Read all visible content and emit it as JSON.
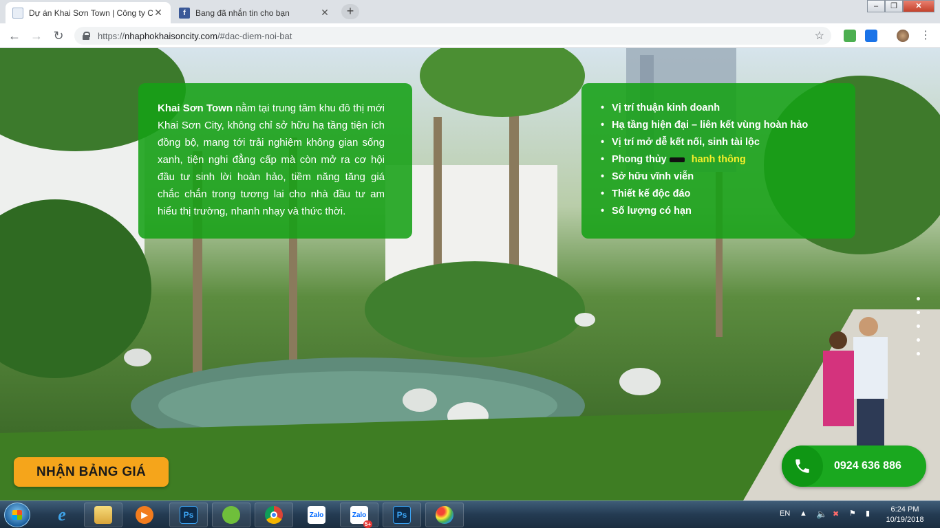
{
  "browser": {
    "tabs": [
      {
        "title": "Dự án Khai Sơn Town | Công ty C",
        "icon": "document-icon",
        "active": true
      },
      {
        "title": "Bang đã nhắn tin cho bạn",
        "icon": "facebook-icon",
        "active": false
      }
    ],
    "new_tab_label": "+",
    "url_prefix": "https://",
    "url_domain": "nhaphokhaisoncity.com",
    "url_path": "/#dac-diem-noi-bat"
  },
  "intro": {
    "brand": "Khai Sơn Town",
    "text": " nằm tại trung tâm khu đô thị mới Khai Sơn City, không chỉ sở hữu hạ tầng tiện ích đồng bộ, mang tới trải nghiệm không gian sống xanh, tiện nghi đẳng cấp mà còn mở ra cơ hội đầu tư sinh lời hoàn hảo, tiềm năng tăng giá chắc chắn trong tương lai cho nhà đầu tư am hiểu thị trường, nhanh nhạy và thức thời."
  },
  "features": {
    "items": [
      "Vị trí thuận kinh doanh",
      "Hạ tầng hiện đại – liên kết vùng hoàn hảo",
      "Vị trí mở dễ kết nối, sinh tài lộc",
      "Phong thủy",
      "Sở hữu vĩnh viễn",
      "Thiết kế độc đáo",
      "Số lượng có hạn"
    ],
    "highlight": "hanh thông"
  },
  "cta": {
    "price_button": "NHẬN BẢNG GIÁ",
    "hotline": "0924 636 886"
  },
  "taskbar": {
    "apps": [
      "explorer-icon",
      "ie-icon",
      "folder-icon",
      "media-player-icon",
      "photoshop-icon",
      "coccoc-icon",
      "chrome-icon",
      "zalo-icon",
      "zalo-badge-icon",
      "photoshop-icon-2",
      "paint-icon"
    ],
    "zalo_label": "Zalo",
    "zalo_badge": "5+",
    "ps_label": "Ps",
    "language": "EN",
    "time": "6:24 PM",
    "date": "10/19/2018"
  },
  "colors": {
    "infobox": "#16a016",
    "highlight": "#f7ef2a",
    "price_button": "#f5a51b",
    "hotline": "#1aa81f"
  }
}
